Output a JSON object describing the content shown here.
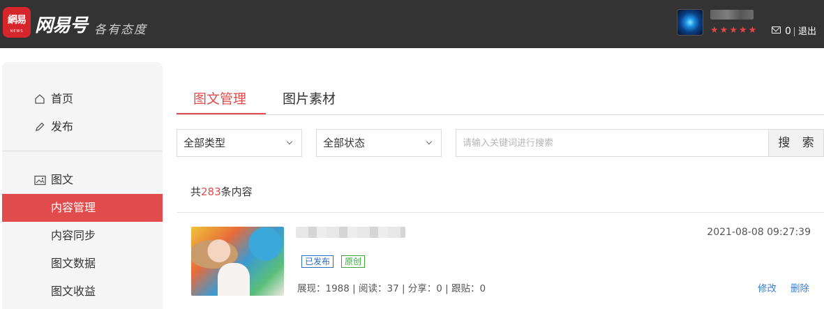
{
  "header": {
    "logo_text": "網易",
    "logo_sub": "NEWS",
    "brand": "网易号",
    "slogan": "各有态度",
    "stars": [
      "★",
      "★",
      "★",
      "★",
      "★"
    ],
    "message_count": "0",
    "logout_label": "退出",
    "colors": {
      "bar": "#333333",
      "logo": "#d7262b",
      "star": "#e64646"
    }
  },
  "sidebar": {
    "top_items": [
      {
        "label": "首页",
        "icon": "home-icon"
      },
      {
        "label": "发布",
        "icon": "pencil-icon"
      }
    ],
    "section": {
      "label": "图文",
      "icon": "image-icon"
    },
    "sub_items": [
      {
        "label": "内容管理",
        "active": true
      },
      {
        "label": "内容同步"
      },
      {
        "label": "图文数据"
      },
      {
        "label": "图文收益"
      }
    ],
    "accent": "#e14b4b"
  },
  "tabs": [
    {
      "label": "图文管理",
      "active": true
    },
    {
      "label": "图片素材"
    }
  ],
  "filters": {
    "type_select": "全部类型",
    "status_select": "全部状态",
    "search_placeholder": "请输入关键词进行搜索",
    "search_button": "搜 索"
  },
  "summary": {
    "prefix": "共",
    "count": "283",
    "suffix": "条内容"
  },
  "articles": [
    {
      "date": "2021-08-08 09:27:39",
      "tags": [
        "已发布",
        "原创"
      ],
      "stats": "展现：1988 | 阅读：37 | 分享：0 | 跟贴：0",
      "actions": {
        "edit": "修改",
        "delete": "删除"
      }
    }
  ]
}
